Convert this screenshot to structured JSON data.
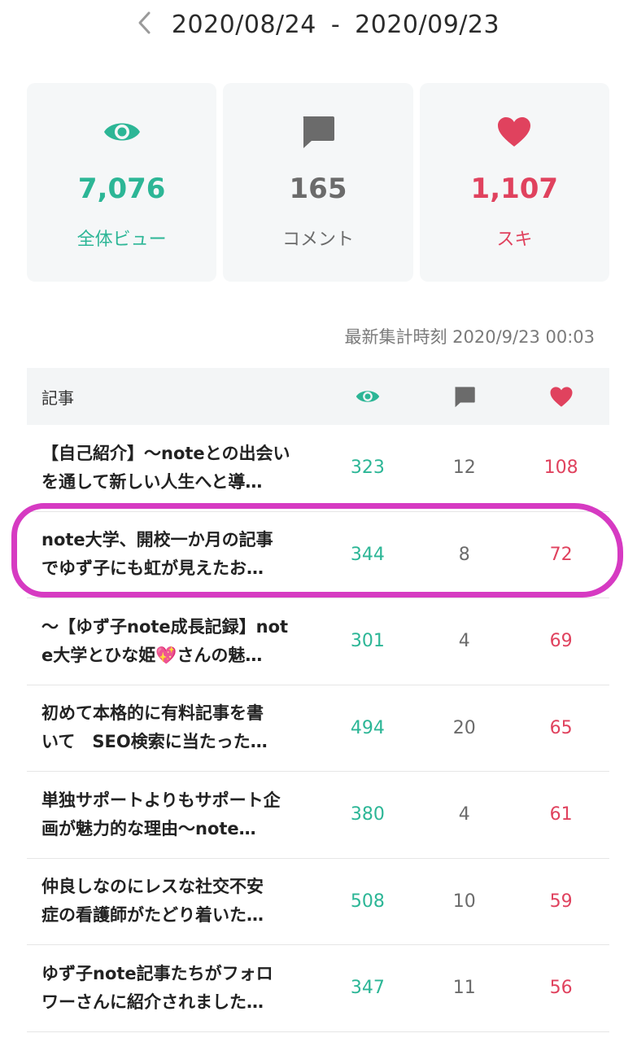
{
  "header": {
    "start_date": "2020/08/24",
    "separator": "-",
    "end_date": "2020/09/23"
  },
  "summary": {
    "views": {
      "value": "7,076",
      "label": "全体ビュー",
      "icon": "eye-icon",
      "color": "#2cb696"
    },
    "comments": {
      "value": "165",
      "label": "コメント",
      "icon": "comment-icon",
      "color": "#6b6b6b"
    },
    "likes": {
      "value": "1,107",
      "label": "スキ",
      "icon": "heart-icon",
      "color": "#e0425e"
    }
  },
  "updated_at": "最新集計時刻 2020/9/23 00:03",
  "table": {
    "header_title": "記事",
    "rows": [
      {
        "line1": "【自己紹介】〜noteとの出会い",
        "line2": "を通して新しい人生へと導…",
        "views": "323",
        "comments": "12",
        "likes": "108"
      },
      {
        "line1": "note大学、開校一か月の記事",
        "line2": "でゆず子にも虹が見えたお…",
        "views": "344",
        "comments": "8",
        "likes": "72"
      },
      {
        "line1": "〜【ゆず子note成長記録】not",
        "line2": "e大学とひな姫💖さんの魅…",
        "views": "301",
        "comments": "4",
        "likes": "69"
      },
      {
        "line1": "初めて本格的に有料記事を書",
        "line2": "いて　SEO検索に当たった…",
        "views": "494",
        "comments": "20",
        "likes": "65"
      },
      {
        "line1": "単独サポートよりもサポート企",
        "line2": "画が魅力的な理由〜note…",
        "views": "380",
        "comments": "4",
        "likes": "61"
      },
      {
        "line1": "仲良しなのにレスな社交不安",
        "line2": "症の看護師がたどり着いた…",
        "views": "508",
        "comments": "10",
        "likes": "59"
      },
      {
        "line1": "ゆず子note記事たちがフォロ",
        "line2": "ワーさんに紹介されました…",
        "views": "347",
        "comments": "11",
        "likes": "56"
      }
    ]
  }
}
